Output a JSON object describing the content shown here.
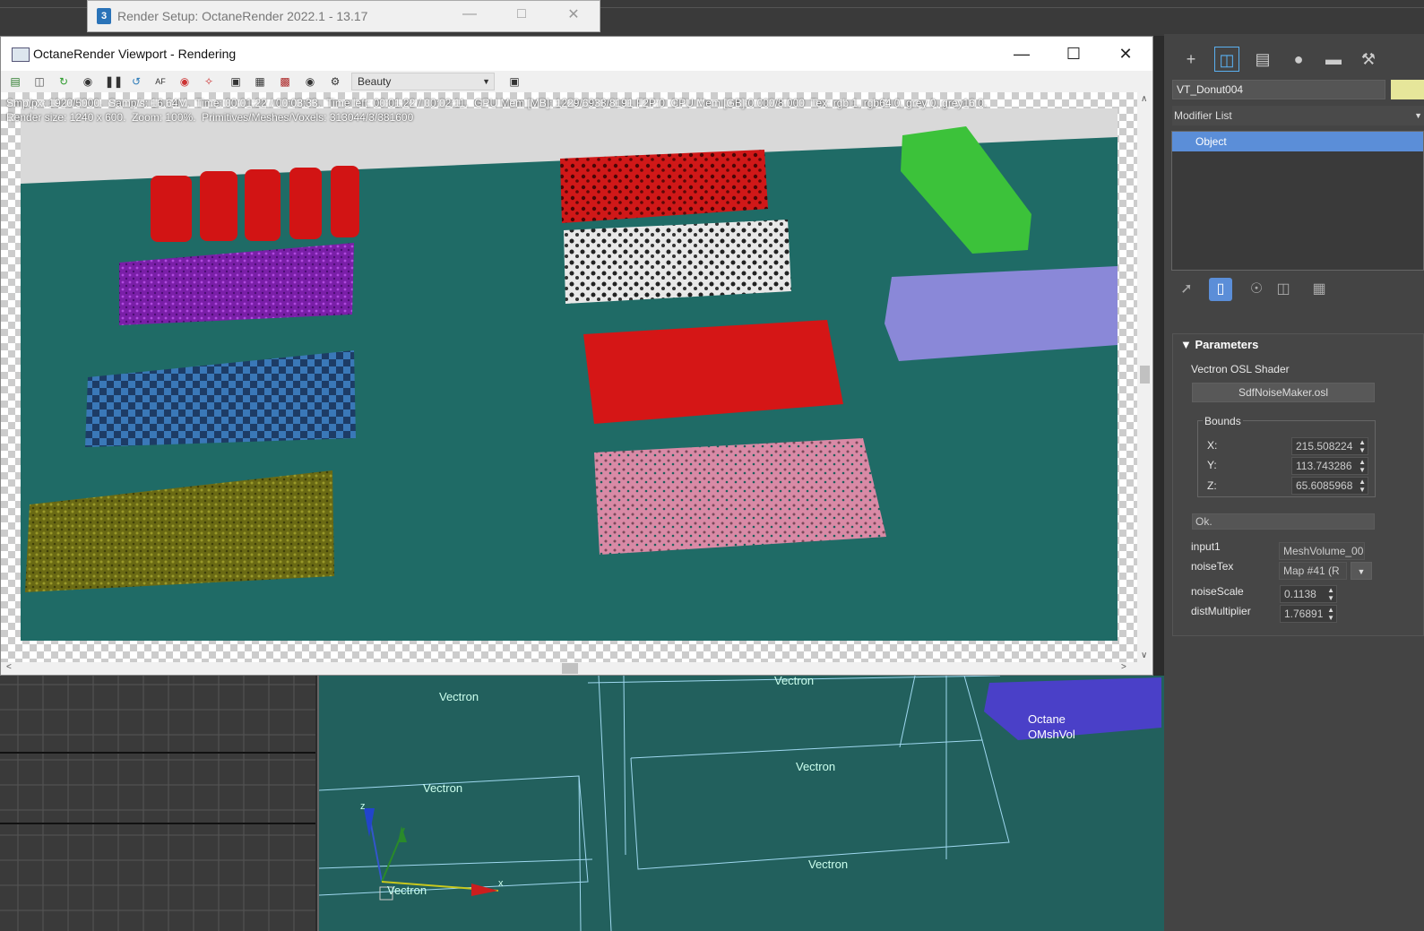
{
  "render_setup": {
    "title": "Render Setup: OctaneRender 2022.1 - 13.17",
    "app_badge": "3"
  },
  "viewport": {
    "title": "OctaneRender Viewport - Rendering",
    "pass": "Beauty",
    "stats_line1": "Smp/px: 1920/5000.  Samp/s: 16.64M.  Time: 00:01:22 / 00:03:33.  Time left: 00:01:22 / 00:02:11.  GPU Mem [MB]: 1229/6933/8191 F2P:0  CPU Mem [GB]:0.000/8.000  Tex: rgb 1, rgb64 0, grey 0, grey16 0.",
    "stats_line2": "Render size: 1240 x 600.  Zoom: 100%.  Primitives/Meshes/Voxels: 313044/3/381600",
    "colors": {
      "floor": "#1f6b66",
      "wall": "#d9d9d9"
    }
  },
  "scene_viewport": {
    "labels": [
      "Vectron",
      "Vectron",
      "Vectron",
      "Vectron",
      "Vectron",
      "Vectron"
    ],
    "octane_label_1": "Octane",
    "octane_label_2": "OMshVol",
    "axis_x": "x",
    "axis_z": "z"
  },
  "command_panel": {
    "object_name": "VT_Donut004",
    "object_color": "#e6e69a",
    "modifier_list": "Modifier List",
    "stack_item": "Object",
    "rollout_title": "Parameters",
    "shader_title": "Vectron OSL Shader",
    "shader_file": "SdfNoiseMaker.osl",
    "bounds_title": "Bounds",
    "bounds": [
      {
        "label": "X:",
        "value": "215.508224"
      },
      {
        "label": "Y:",
        "value": "113.743286"
      },
      {
        "label": "Z:",
        "value": "65.6085968"
      }
    ],
    "status": "Ok.",
    "params": [
      {
        "label": "input1",
        "value": "MeshVolume_00"
      },
      {
        "label": "noiseTex",
        "value": "Map #41 (R"
      },
      {
        "label": "noiseScale",
        "value": "0.1138"
      },
      {
        "label": "distMultiplier",
        "value": "1.76891"
      }
    ]
  }
}
